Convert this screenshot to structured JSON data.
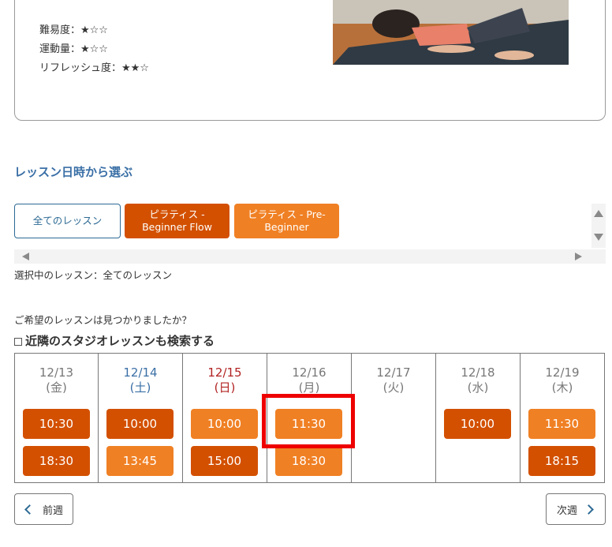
{
  "lesson_info": {
    "difficulty": "難易度：★☆☆",
    "exercise": "運動量：★☆☆",
    "refresh": "リフレッシュ度：★★☆"
  },
  "section_title": "レッスン日時から選ぶ",
  "filters": {
    "all": "全てのレッスン",
    "b1_line1": "ピラティス -",
    "b1_line2": "Beginner Flow",
    "b2_line1": "ピラティス - Pre-",
    "b2_line2": "Beginner"
  },
  "selected_text": "選択中のレッスン：全てのレッスン",
  "found_question": "ご希望のレッスンは見つかりましたか？",
  "nearby_label": "近隣のスタジオレッスンも検索する",
  "days": [
    {
      "date": "12/13",
      "dow": "(金)",
      "slots": [
        "10:30",
        "18:30"
      ]
    },
    {
      "date": "12/14",
      "dow": "(土)",
      "slots": [
        "10:00",
        "13:45"
      ]
    },
    {
      "date": "12/15",
      "dow": "(日)",
      "slots": [
        "10:00",
        "15:00"
      ]
    },
    {
      "date": "12/16",
      "dow": "(月)",
      "slots": [
        "11:30",
        "18:30"
      ]
    },
    {
      "date": "12/17",
      "dow": "(火)",
      "slots": []
    },
    {
      "date": "12/18",
      "dow": "(水)",
      "slots": [
        "10:00"
      ]
    },
    {
      "date": "12/19",
      "dow": "(木)",
      "slots": [
        "11:30",
        "18:15"
      ]
    }
  ],
  "nav": {
    "prev": "前週",
    "next": "次週"
  },
  "colors": {
    "dark_slot": "#d35000",
    "light_slot": "#f08024",
    "link_blue": "#3a6fa6",
    "highlight": "#ee0000"
  }
}
